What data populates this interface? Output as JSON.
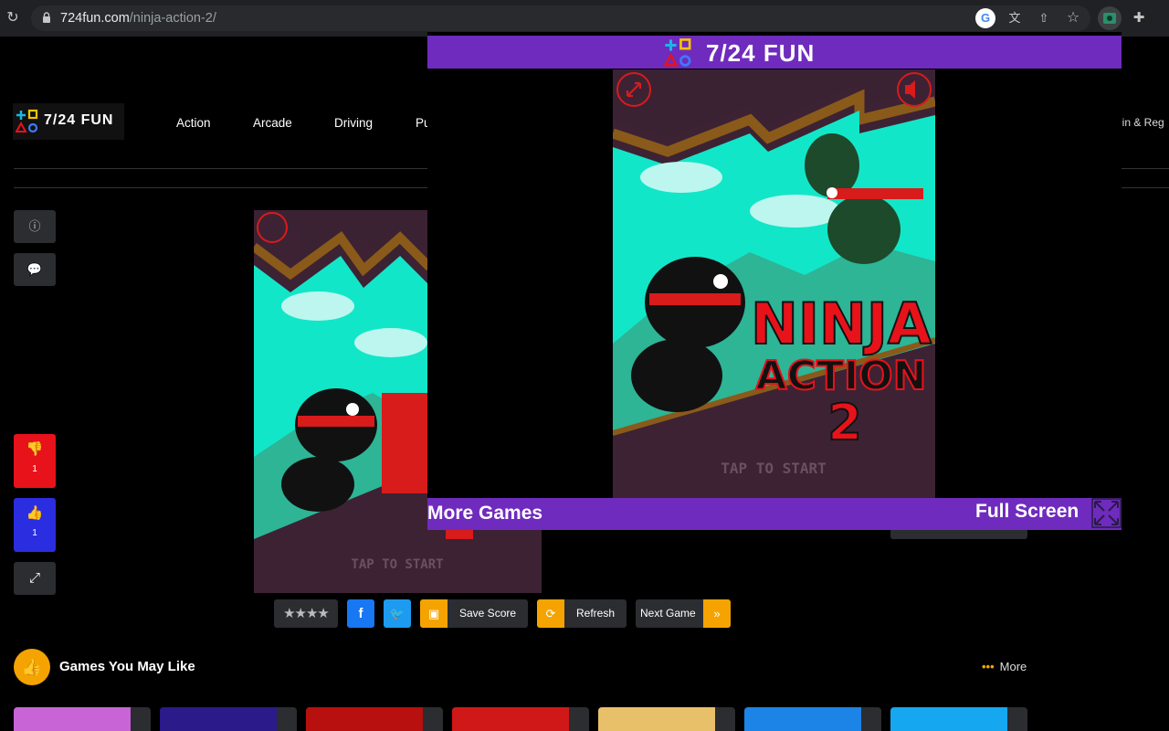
{
  "browser": {
    "url_host": "724fun.com",
    "url_path": "/ninja-action-2/"
  },
  "site": {
    "logo_text": "7/24 FUN",
    "nav": [
      "Action",
      "Arcade",
      "Driving",
      "Pu"
    ],
    "login_label": "gin & Reg"
  },
  "sidebar": {
    "info_icon": "info-icon",
    "comment_icon": "comment-icon",
    "dislike_count": "1",
    "like_count": "1",
    "expand_icon": "expand-icon"
  },
  "toolbar": {
    "stars": "★★★★",
    "save_label": "Save Score",
    "refresh_label": "Refresh",
    "next_label": "Next Game",
    "next_arrow": "»"
  },
  "related": {
    "title": "Games You May Like",
    "more_label": "More",
    "more_dots": "•••"
  },
  "game": {
    "title_line1": "NINJA",
    "title_line2": "ACTION",
    "title_line3": "2",
    "tap_label": "TAP TO START"
  },
  "overlay": {
    "header_title": "7/24 FUN",
    "more_games_label": "More Games",
    "full_screen_label": "Full Screen"
  },
  "colors": {
    "brand_purple": "#6f2bbd",
    "accent_orange": "#f5a300",
    "dislike_red": "#e8121b",
    "like_blue": "#2b2de0",
    "facebook": "#1877f2",
    "twitter": "#1d9bf0",
    "game_teal": "#12e6c8",
    "game_plum": "#3d2234"
  }
}
